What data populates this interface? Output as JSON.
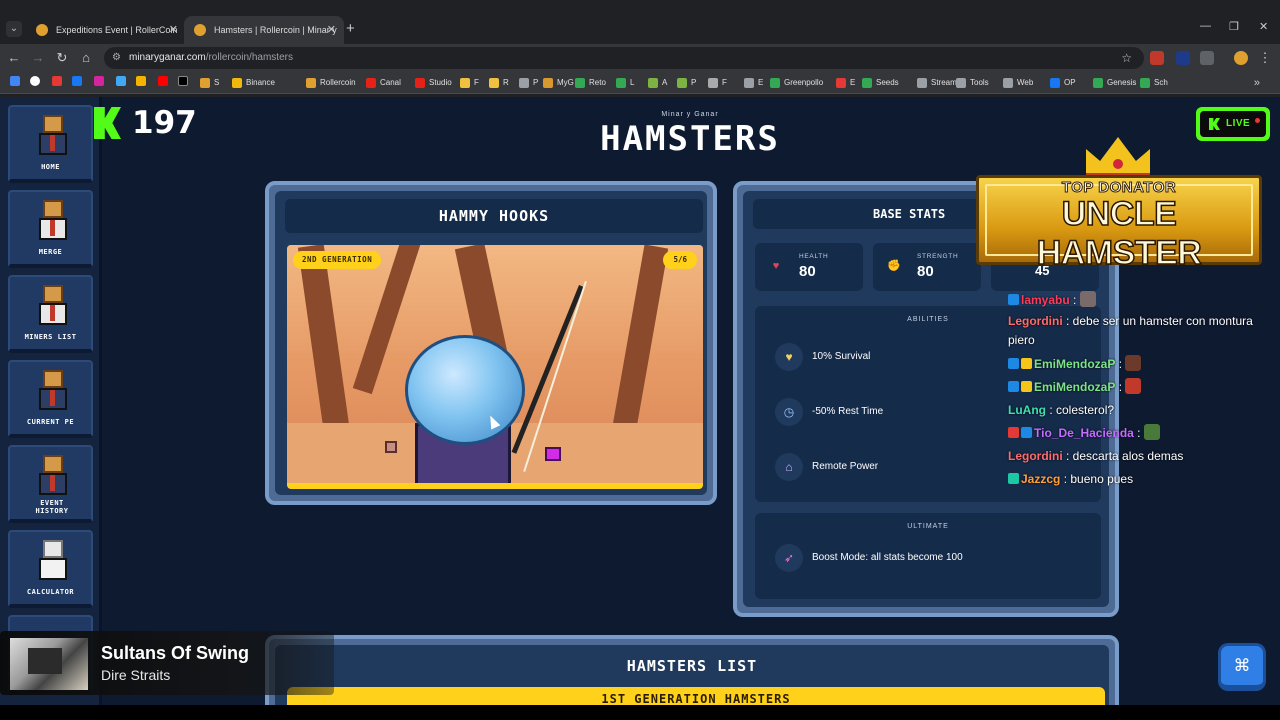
{
  "browser": {
    "tabs": [
      {
        "title": "Expeditions Event | RollerCoin"
      },
      {
        "title": "Hamsters | Rollercoin | Minar y"
      }
    ],
    "url_host": "minaryganar.com",
    "url_path": "/rollercoin/hamsters",
    "bookmarks": [
      {
        "label": "S",
        "color": "#e0a030"
      },
      {
        "label": "Binance",
        "color": "#f0b90b"
      },
      {
        "label": "Rollercoin",
        "color": "#e0a030"
      },
      {
        "label": "Canal",
        "color": "#e62117"
      },
      {
        "label": "Studio",
        "color": "#e62117"
      },
      {
        "label": "F",
        "color": "#f0c040"
      },
      {
        "label": "R",
        "color": "#f0c040"
      },
      {
        "label": "P",
        "color": "#9aa0a6"
      },
      {
        "label": "MyG",
        "color": "#d89a30"
      },
      {
        "label": "Reto",
        "color": "#34a853"
      },
      {
        "label": "L",
        "color": "#34a853"
      },
      {
        "label": "A",
        "color": "#7cb342"
      },
      {
        "label": "P",
        "color": "#7cb342"
      },
      {
        "label": "F",
        "color": "#aaaaaa"
      },
      {
        "label": "E",
        "color": "#9aa0a6"
      },
      {
        "label": "Greenpollo",
        "color": "#34a853"
      },
      {
        "label": "E",
        "color": "#e53935"
      },
      {
        "label": "Seeds",
        "color": "#34a853"
      },
      {
        "label": "Stream",
        "color": "#9aa0a6"
      },
      {
        "label": "Tools",
        "color": "#9aa0a6"
      },
      {
        "label": "Web",
        "color": "#9aa0a6"
      },
      {
        "label": "OP",
        "color": "#1877f2"
      },
      {
        "label": "Genesis",
        "color": "#34a853"
      },
      {
        "label": "Sch",
        "color": "#34a853"
      }
    ]
  },
  "counter": {
    "value": "197"
  },
  "site": {
    "subtitle": "Minar y Ganar",
    "title": "HAMSTERS"
  },
  "live": {
    "label": "LIVE"
  },
  "sidebar": {
    "items": [
      {
        "label": "HOME"
      },
      {
        "label": "MERGE"
      },
      {
        "label": "MINERS LIST"
      },
      {
        "label": "CURRENT PE"
      },
      {
        "label": "EVENT HISTORY"
      },
      {
        "label": "CALCULATOR"
      }
    ]
  },
  "hamster": {
    "name": "HAMMY HOOKS",
    "generation": "2ND GENERATION",
    "count": "5/6"
  },
  "stats": {
    "title": "BASE STATS",
    "items": [
      {
        "label": "HEALTH",
        "value": "80",
        "icon": "heart-icon"
      },
      {
        "label": "STRENGTH",
        "value": "80",
        "icon": "fist-icon"
      },
      {
        "value": "45"
      }
    ],
    "abilities_heading": "ABILITIES",
    "abilities": [
      {
        "text": "10% Survival",
        "icon": "heart-shield-icon"
      },
      {
        "text": "-50% Rest Time",
        "icon": "stopwatch-icon"
      },
      {
        "text": "Remote Power",
        "icon": "plug-icon"
      }
    ],
    "ultimate_heading": "ULTIMATE",
    "ultimate": {
      "text": "Boost Mode: all stats become 100",
      "icon": "rocket-icon"
    }
  },
  "list": {
    "title": "HAMSTERS LIST",
    "gen_title": "1ST GENERATION HAMSTERS"
  },
  "donator": {
    "top": "TOP DONATOR",
    "name": "UNCLE HAMSTER"
  },
  "chat": [
    {
      "user": "lamyabu",
      "color": "#ff3b5c",
      "text": ":"
    },
    {
      "user": "Legordini",
      "color": "#ff6b6b",
      "text": ": debe ser un hamster con montura piero"
    },
    {
      "user": "EmiMendozaP",
      "color": "#7be38a",
      "text": ":"
    },
    {
      "user": "EmiMendozaP",
      "color": "#7be38a",
      "text": ":"
    },
    {
      "user": "LuAng",
      "color": "#3ee0b0",
      "text": ": colesterol?"
    },
    {
      "user": "Tio_De_Hacienda",
      "color": "#c36cff",
      "text": ":"
    },
    {
      "user": "Legordini",
      "color": "#ff6b6b",
      "text": ": descarta alos demas"
    },
    {
      "user": "Jazzcg",
      "color": "#ff9f3b",
      "text": ": bueno pues"
    }
  ],
  "music": {
    "song": "Sultans Of Swing",
    "artist": "Dire Straits"
  }
}
